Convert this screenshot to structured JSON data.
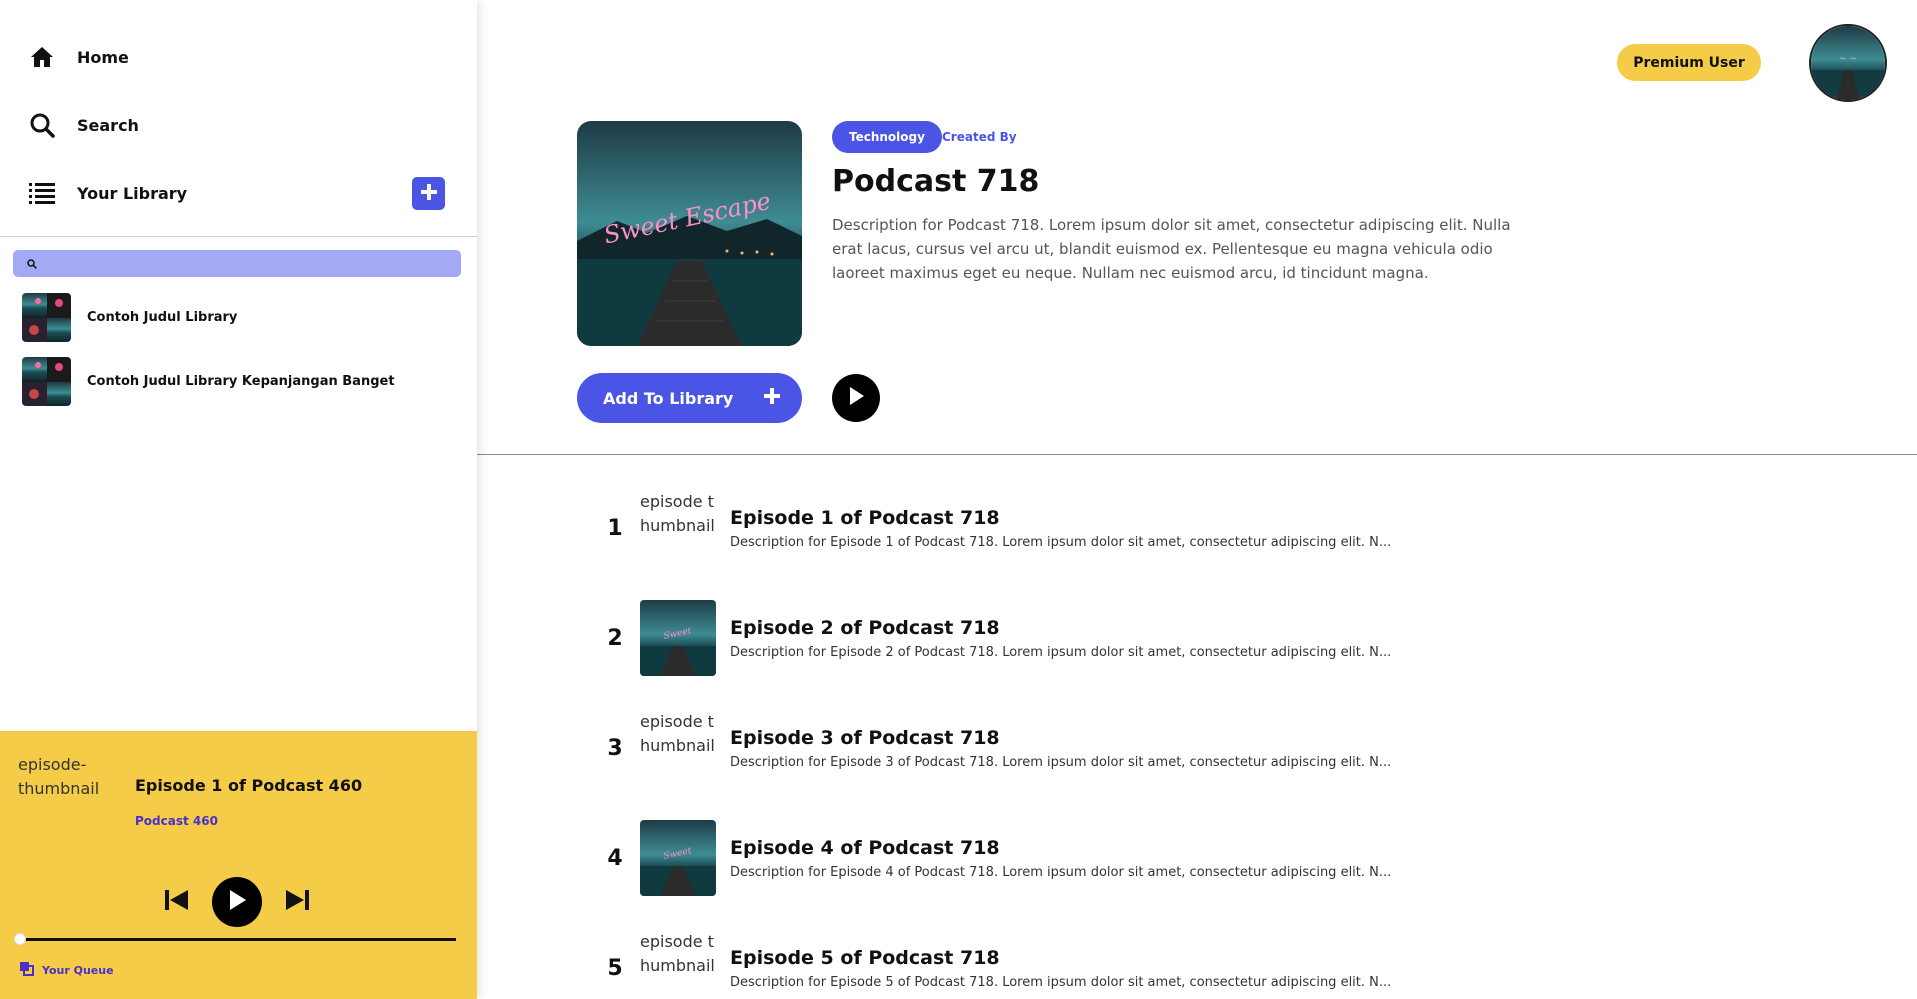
{
  "sidebar": {
    "nav": [
      {
        "label": "Home",
        "icon": "home-icon"
      },
      {
        "label": "Search",
        "icon": "search-icon"
      },
      {
        "label": "Your Library",
        "icon": "list-icon"
      }
    ],
    "add_library_icon": "plus-icon",
    "search": {
      "placeholder": ""
    },
    "library_items": [
      {
        "label": "Contoh Judul Library"
      },
      {
        "label": "Contoh Judul Library Kepanjangan Banget"
      }
    ]
  },
  "player": {
    "thumbnail_alt": "episode-thumbnail",
    "episode_title": "Episode 1 of Podcast 460",
    "podcast_name": "Podcast 460",
    "progress": 0,
    "queue_label": "Your Queue"
  },
  "header": {
    "premium_label": "Premium User"
  },
  "podcast": {
    "category": "Technology",
    "created_by": "Created By",
    "title": "Podcast 718",
    "description": "Description for Podcast 718. Lorem ipsum dolor sit amet, consectetur adipiscing elit. Nulla erat lacus, cursus vel arcu ut, blandit euismod ex. Pellentesque eu magna vehicula odio laoreet maximus eget eu neque. Nullam nec euismod arcu, id tincidunt magna.",
    "add_to_library_label": "Add To Library",
    "cover_text": "Sweet Escape"
  },
  "episodes": [
    {
      "num": "1",
      "thumb_alt": "episode thumbnail",
      "thumb_loaded": false,
      "title": "Episode 1 of Podcast 718",
      "desc": "Description for Episode 1 of Podcast 718. Lorem ipsum dolor sit amet, consectetur adipiscing elit. N..."
    },
    {
      "num": "2",
      "thumb_alt": "episode thumbnail",
      "thumb_loaded": true,
      "title": "Episode 2 of Podcast 718",
      "desc": "Description for Episode 2 of Podcast 718. Lorem ipsum dolor sit amet, consectetur adipiscing elit. N..."
    },
    {
      "num": "3",
      "thumb_alt": "episode thumbnail",
      "thumb_loaded": false,
      "title": "Episode 3 of Podcast 718",
      "desc": "Description for Episode 3 of Podcast 718. Lorem ipsum dolor sit amet, consectetur adipiscing elit. N..."
    },
    {
      "num": "4",
      "thumb_alt": "episode thumbnail",
      "thumb_loaded": true,
      "title": "Episode 4 of Podcast 718",
      "desc": "Description for Episode 4 of Podcast 718. Lorem ipsum dolor sit amet, consectetur adipiscing elit. N..."
    },
    {
      "num": "5",
      "thumb_alt": "episode thumbnail",
      "thumb_loaded": false,
      "title": "Episode 5 of Podcast 718",
      "desc": "Description for Episode 5 of Podcast 718. Lorem ipsum dolor sit amet, consectetur adipiscing elit. N..."
    }
  ],
  "colors": {
    "accent": "#4a55e6",
    "player_bg": "#f5cc48",
    "search_bg": "#a4a9f6",
    "link_purple": "#4b2fc9"
  }
}
